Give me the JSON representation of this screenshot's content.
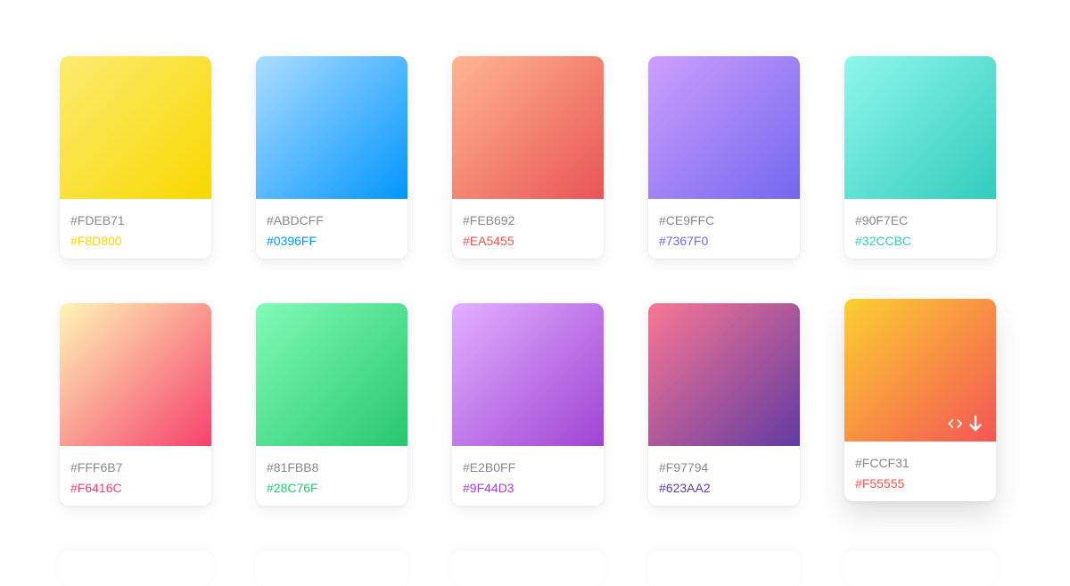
{
  "palettes": [
    {
      "color1": "#FDEB71",
      "color2": "#F8D800"
    },
    {
      "color1": "#ABDCFF",
      "color2": "#0396FF"
    },
    {
      "color1": "#FEB692",
      "color2": "#EA5455"
    },
    {
      "color1": "#CE9FFC",
      "color2": "#7367F0"
    },
    {
      "color1": "#90F7EC",
      "color2": "#32CCBC"
    },
    {
      "color1": "#FFF6B7",
      "color2": "#F6416C"
    },
    {
      "color1": "#81FBB8",
      "color2": "#28C76F"
    },
    {
      "color1": "#E2B0FF",
      "color2": "#9F44D3"
    },
    {
      "color1": "#F97794",
      "color2": "#623AA2"
    },
    {
      "color1": "#FCCF31",
      "color2": "#F55555"
    }
  ],
  "actions": {
    "code_icon": "code-icon",
    "download_icon": "download-icon"
  }
}
